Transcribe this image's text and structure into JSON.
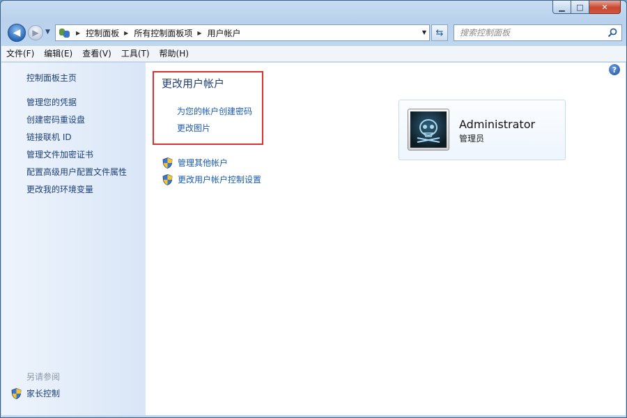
{
  "window": {
    "caption": {
      "minimize_icon": "minimize-icon",
      "maximize_icon": "maximize-icon",
      "close_icon": "close-icon"
    }
  },
  "nav": {
    "breadcrumb": [
      "控制面板",
      "所有控制面板项",
      "用户帐户"
    ],
    "search_placeholder": "搜索控制面板"
  },
  "menu": [
    "文件(F)",
    "编辑(E)",
    "查看(V)",
    "工具(T)",
    "帮助(H)"
  ],
  "sidebar": {
    "home": "控制面板主页",
    "items": [
      "管理您的凭据",
      "创建密码重设盘",
      "链接联机 ID",
      "管理文件加密证书",
      "配置高级用户配置文件属性",
      "更改我的环境变量"
    ],
    "see_also": "另请参阅",
    "parental_controls": "家长控制"
  },
  "main": {
    "title": "更改用户帐户",
    "tasks": [
      "为您的帐户创建密码",
      "更改图片"
    ],
    "admin_tasks": [
      "管理其他帐户",
      "更改用户帐户控制设置"
    ]
  },
  "user": {
    "name": "Administrator",
    "role": "管理员"
  },
  "colors": {
    "link": "#1a5bb0",
    "title": "#1d3c75",
    "highlight_box": "#d9312f"
  }
}
